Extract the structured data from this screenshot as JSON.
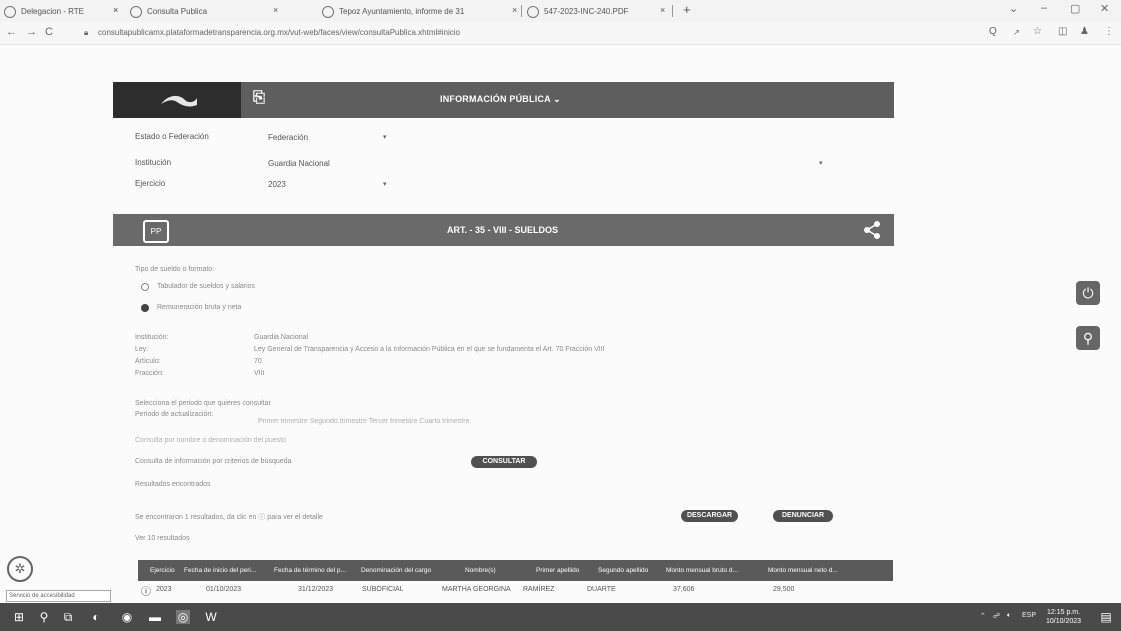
{
  "browser": {
    "tabs": [
      {
        "title": "Delegacion - RTE"
      },
      {
        "title": "Consulta Publica"
      },
      {
        "title": "Tepoz Ayuntamiento, informe de 31"
      },
      {
        "title": "547-2023-INC-240.PDF"
      }
    ],
    "url": "consultapublicamx.plataformadetransparencia.org.mx/vut-web/faces/view/consultaPublica.xhtml#inicio",
    "nav": {
      "back": "←",
      "forward": "→",
      "reload": "C"
    }
  },
  "header": {
    "title": "INFORMACIÓN PÚBLICA ⌄"
  },
  "filters": {
    "estado_label": "Estado o Federación",
    "estado_value": "Federación",
    "institucion_label": "Institución",
    "institucion_value": "Guardia Nacional",
    "ejercicio_label": "Ejercicio",
    "ejercicio_value": "2023"
  },
  "section": {
    "title": "ART. - 35 - VIII - SUELDOS",
    "icon_text": "PP"
  },
  "tipo_label": "Tipo de sueldo o formato:",
  "radios": [
    {
      "label": "Tabulador de sueldos y salarios",
      "selected": false
    },
    {
      "label": "Remuneración bruta y neta",
      "selected": true
    }
  ],
  "info": {
    "institucion_label": "Institución:",
    "institucion_value": "Guardia Nacional",
    "ley_label": "Ley:",
    "ley_value": "Ley General de Transparencia y Acceso a la Información Pública en el que se fundamenta el Art. 70 Fracción VIII",
    "articulo_label": "Artículo:",
    "articulo_value": "70",
    "fraccion_label": "Fracción:",
    "fraccion_value": "VIII"
  },
  "periodo_label": "Selecciona el periodo que quieres consultar",
  "periodo_sub": "Periodo de actualización:",
  "periodo_options": "Primer trimestre      Segundo trimestre      Tercer trimestre      Cuarto trimestre",
  "hint": "Consulta por nombre o denominación del puesto",
  "search_label": "Consulta de información por criterios de búsqueda",
  "consultar": "CONSULTAR",
  "results_label": "Resultados encontrados",
  "records_label": "Se encontraron 1 resultados, da clic en ⓘ para ver el detalle",
  "descargar": "DESCARGAR",
  "denunciar": "DENUNCIAR",
  "show_label": "Ver 10 resultados",
  "table": {
    "headers": [
      "Ejercicio",
      "Fecha de inicio del peri...",
      "Fecha de término del p...",
      "Denominación del cargo",
      "Nombre(s)",
      "Primer apellido",
      "Segundo apellido",
      "Monto mensual bruto d...",
      "Monto mensual neto d..."
    ],
    "row": [
      "2023",
      "01/10/2023",
      "31/12/2023",
      "SUBOFICIAL",
      "MARTHA GEORGINA",
      "RAMÍREZ",
      "DUARTE",
      "37,606",
      "29,500"
    ]
  },
  "tooltip": "Servicio de accesibilidad",
  "taskbar": {
    "time": "12:15 p.m.",
    "date": "10/10/2023",
    "lang": "ESP"
  }
}
